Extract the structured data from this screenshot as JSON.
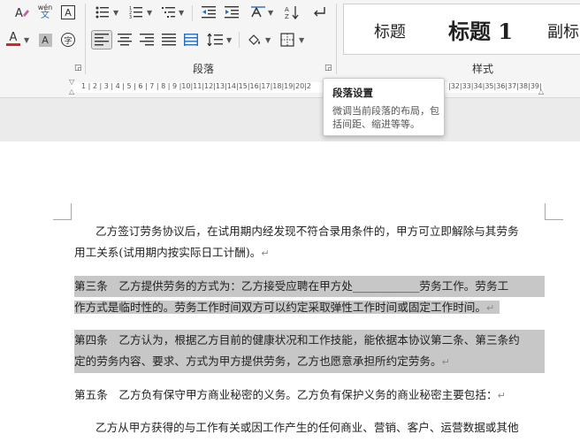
{
  "ribbon": {
    "font_group": {
      "icons": [
        "clear-format-icon",
        "phonetic-guide-icon",
        "character-border-icon",
        "font-color-icon",
        "character-shading-icon",
        "enclose-characters-icon"
      ],
      "phonetic_glyph_top": "wén",
      "phonetic_glyph_bottom": "文",
      "font_color_letter": "A",
      "shading_letter": "A",
      "border_letter": "A",
      "enclose_char": "字",
      "font_color": "#e02020"
    },
    "paragraph_group": {
      "label": "段落",
      "icons": [
        "bullets-icon",
        "numbering-icon",
        "multilevel-list-icon",
        "decrease-indent-icon",
        "increase-indent-icon",
        "chinese-layout-icon",
        "sort-icon",
        "show-paragraph-marks-icon",
        "align-left-icon",
        "center-icon",
        "align-right-icon",
        "justify-icon",
        "distributed-icon",
        "line-spacing-icon",
        "shading-icon",
        "borders-icon"
      ],
      "active": "align-left-icon"
    },
    "styles_group": {
      "label": "样式",
      "items": [
        "标题",
        "标题 1",
        "副标"
      ]
    }
  },
  "ruler": {
    "numbers_left": "1 | 2 | 3 | 4 | 5 | 6 | 7 | 8 | 9 |10|11|12|13|14|15|16|17|18|19|20|2",
    "numbers_right": "|32|33|34|35|36|37|38|39|"
  },
  "tooltip": {
    "title": "段落设置",
    "description": "微调当前段落的布局，包括间距、缩进等等。"
  },
  "document": {
    "paragraphs": [
      {
        "lines": [
          "乙方签订劳务协议后，在试用期内经发现不符合录用条件的，甲方可立即解除与其劳务",
          "用工关系(试用期内按实际日工计酬)。"
        ],
        "highlight": false
      },
      {
        "lines": [
          "第三条　乙方提供劳务的方式为：乙方接受应聘在甲方处____________劳务工作。劳务工",
          "作方式是临时性的。劳务工作时间双方可以约定采取弹性工作时间或固定工作时间。"
        ],
        "highlight": true
      },
      {
        "lines": [
          "第四条　乙方认为，根据乙方目前的健康状况和工作技能，能依据本协议第二条、第三条约",
          "定的劳务内容、要求、方式为甲方提供劳务，乙方也愿意承担所约定劳务。"
        ],
        "highlight": true
      },
      {
        "lines": [
          "第五条　乙方负有保守甲方商业秘密的义务。乙方负有保护义务的商业秘密主要包括："
        ],
        "highlight": false
      },
      {
        "lines": [
          "乙方从甲方获得的与工作有关或因工作产生的任何商业、营销、客户、运营数据或其他"
        ],
        "highlight": false
      }
    ],
    "paragraph_mark": "↵"
  }
}
